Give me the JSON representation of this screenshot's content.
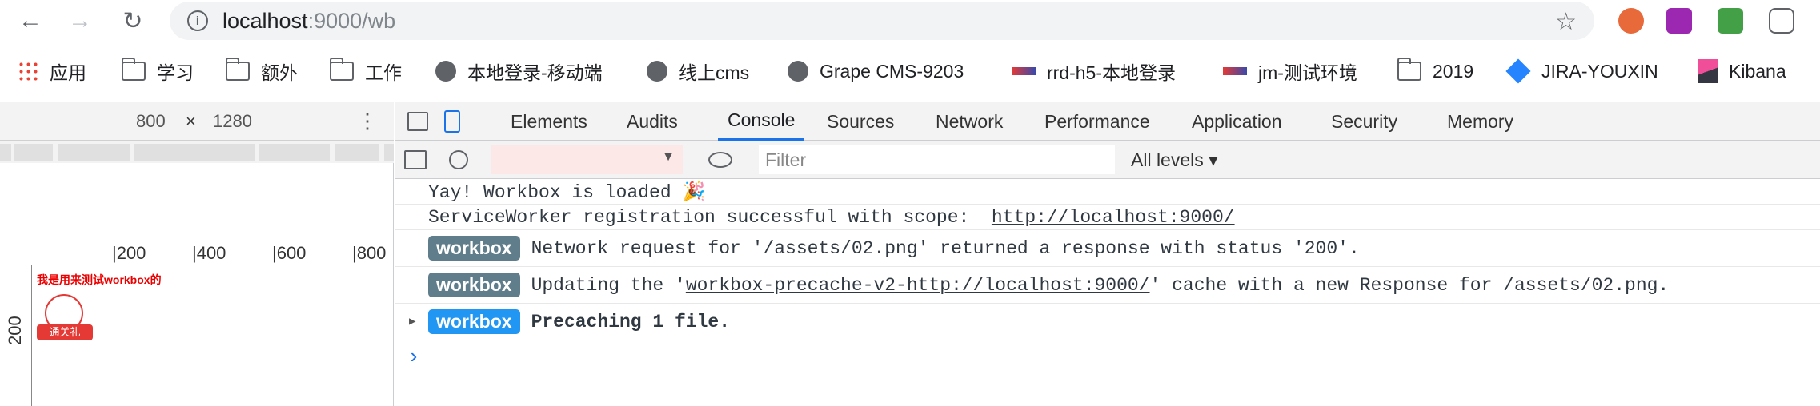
{
  "browser": {
    "url_host": "localhost",
    "url_rest": ":9000/wb",
    "nav": {
      "back": "←",
      "forward": "→",
      "reload": "↻",
      "star": "☆",
      "info": "i"
    },
    "extensions": [
      "ublock-icon",
      "rp-icon",
      "download-icon",
      "pocket-icon"
    ]
  },
  "bookmarks": [
    {
      "label": "应用",
      "icon": "apps-icon"
    },
    {
      "label": "学习",
      "icon": "folder-icon"
    },
    {
      "label": "额外",
      "icon": "folder-icon"
    },
    {
      "label": "工作",
      "icon": "folder-icon"
    },
    {
      "label": "本地登录-移动端",
      "icon": "globe-icon"
    },
    {
      "label": "线上cms",
      "icon": "globe-icon"
    },
    {
      "label": "Grape CMS-9203",
      "icon": "globe-icon"
    },
    {
      "label": "rrd-h5-本地登录",
      "icon": "site-icon"
    },
    {
      "label": "jm-测试环境",
      "icon": "site-icon"
    },
    {
      "label": "2019",
      "icon": "folder-icon"
    },
    {
      "label": "JIRA-YOUXIN",
      "icon": "jira-icon"
    },
    {
      "label": "Kibana",
      "icon": "kibana-icon"
    }
  ],
  "device": {
    "width": "800",
    "x": "×",
    "height": "1280",
    "more": "⋮",
    "ruler_labels": [
      "|200",
      "|400",
      "|600",
      "|800"
    ],
    "ruler_left": "200",
    "page_text": "我是用来测试workbox的",
    "ribbon_text": "通关礼"
  },
  "devtools": {
    "tabs": [
      "Elements",
      "Audits",
      "Console",
      "Sources",
      "Network",
      "Performance",
      "Application",
      "Security",
      "Memory"
    ],
    "active_tab": "Console",
    "filter_placeholder": "Filter",
    "levels": "All levels ▾",
    "context_arrow": "▼"
  },
  "console": {
    "line1": "Yay! Workbox is loaded 🎉",
    "line2_prefix": "ServiceWorker registration successful with scope:  ",
    "line2_link": "http://localhost:9000/",
    "badge": "workbox",
    "line3": "Network request for '/assets/02.png' returned a response with status '200'.",
    "line4_prefix": "Updating the '",
    "line4_link": "workbox-precache-v2-http://localhost:9000/",
    "line4_suffix": "' cache with a new Response for /assets/02.png.",
    "line5": "Precaching 1 file.",
    "prompt": "›",
    "expand": "▶"
  }
}
